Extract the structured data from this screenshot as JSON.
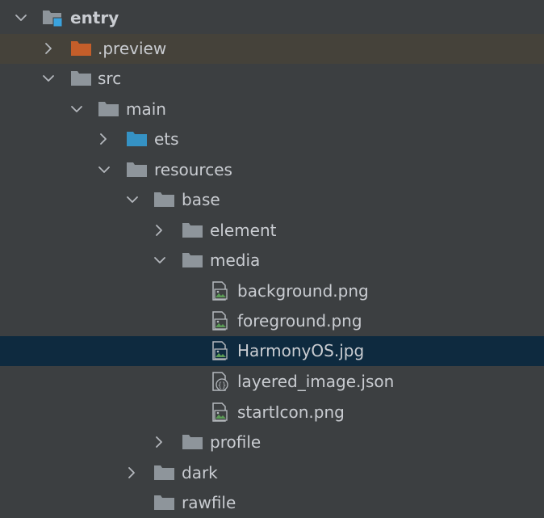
{
  "colors": {
    "background": "#3c3f41",
    "preview_row_background": "#45423a",
    "selected_row_background": "#0e2a3f",
    "text": "#c9ccd1",
    "folder_gray": "#8e959b",
    "folder_orange": "#c45e2a",
    "folder_blue": "#3592c4",
    "module_marker": "#3aa3de",
    "image_green": "#5b9b55"
  },
  "tree": {
    "items": [
      {
        "label": "entry",
        "icon": "module-folder-icon",
        "chevron": "expanded"
      },
      {
        "label": ".preview",
        "icon": "excluded-folder-icon",
        "chevron": "collapsed"
      },
      {
        "label": "src",
        "icon": "folder-icon",
        "chevron": "expanded"
      },
      {
        "label": "main",
        "icon": "folder-icon",
        "chevron": "expanded"
      },
      {
        "label": "ets",
        "icon": "source-folder-icon",
        "chevron": "collapsed"
      },
      {
        "label": "resources",
        "icon": "folder-icon",
        "chevron": "expanded"
      },
      {
        "label": "base",
        "icon": "folder-icon",
        "chevron": "expanded"
      },
      {
        "label": "element",
        "icon": "folder-icon",
        "chevron": "collapsed"
      },
      {
        "label": "media",
        "icon": "folder-icon",
        "chevron": "expanded"
      },
      {
        "label": "background.png",
        "icon": "image-file-icon",
        "chevron": "none"
      },
      {
        "label": "foreground.png",
        "icon": "image-file-icon",
        "chevron": "none"
      },
      {
        "label": "HarmonyOS.jpg",
        "icon": "image-file-icon",
        "chevron": "none",
        "selected": true
      },
      {
        "label": "layered_image.json",
        "icon": "json-file-icon",
        "chevron": "none"
      },
      {
        "label": "startIcon.png",
        "icon": "image-file-icon",
        "chevron": "none"
      },
      {
        "label": "profile",
        "icon": "folder-icon",
        "chevron": "collapsed"
      },
      {
        "label": "dark",
        "icon": "folder-icon",
        "chevron": "collapsed"
      },
      {
        "label": "rawfile",
        "icon": "folder-icon",
        "chevron": "none"
      }
    ]
  }
}
